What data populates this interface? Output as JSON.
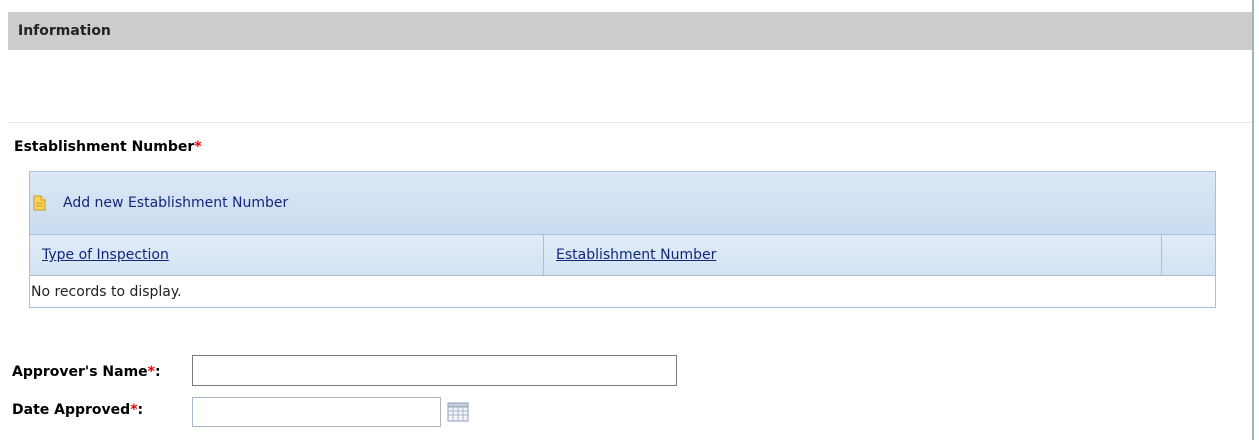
{
  "section": {
    "title": "Information"
  },
  "establishment": {
    "label": "Establishment Number",
    "required_mark": "*",
    "add_label": "Add new Establishment Number",
    "columns": [
      "Type of Inspection",
      "Establishment Number",
      ""
    ],
    "empty_message": "No records to display."
  },
  "approver": {
    "label": "Approver's Name",
    "required_mark": "*",
    "colon": ":",
    "value": "",
    "placeholder": ""
  },
  "date_approved": {
    "label": "Date Approved",
    "required_mark": "*",
    "colon": ":",
    "value": "",
    "placeholder": ""
  },
  "colors": {
    "header_bg": "#cccccc",
    "required": "#e60000",
    "link": "#11287a",
    "grid_border": "#a8c0dc"
  },
  "icons": {
    "add": "document-add-icon",
    "calendar": "calendar-icon"
  }
}
